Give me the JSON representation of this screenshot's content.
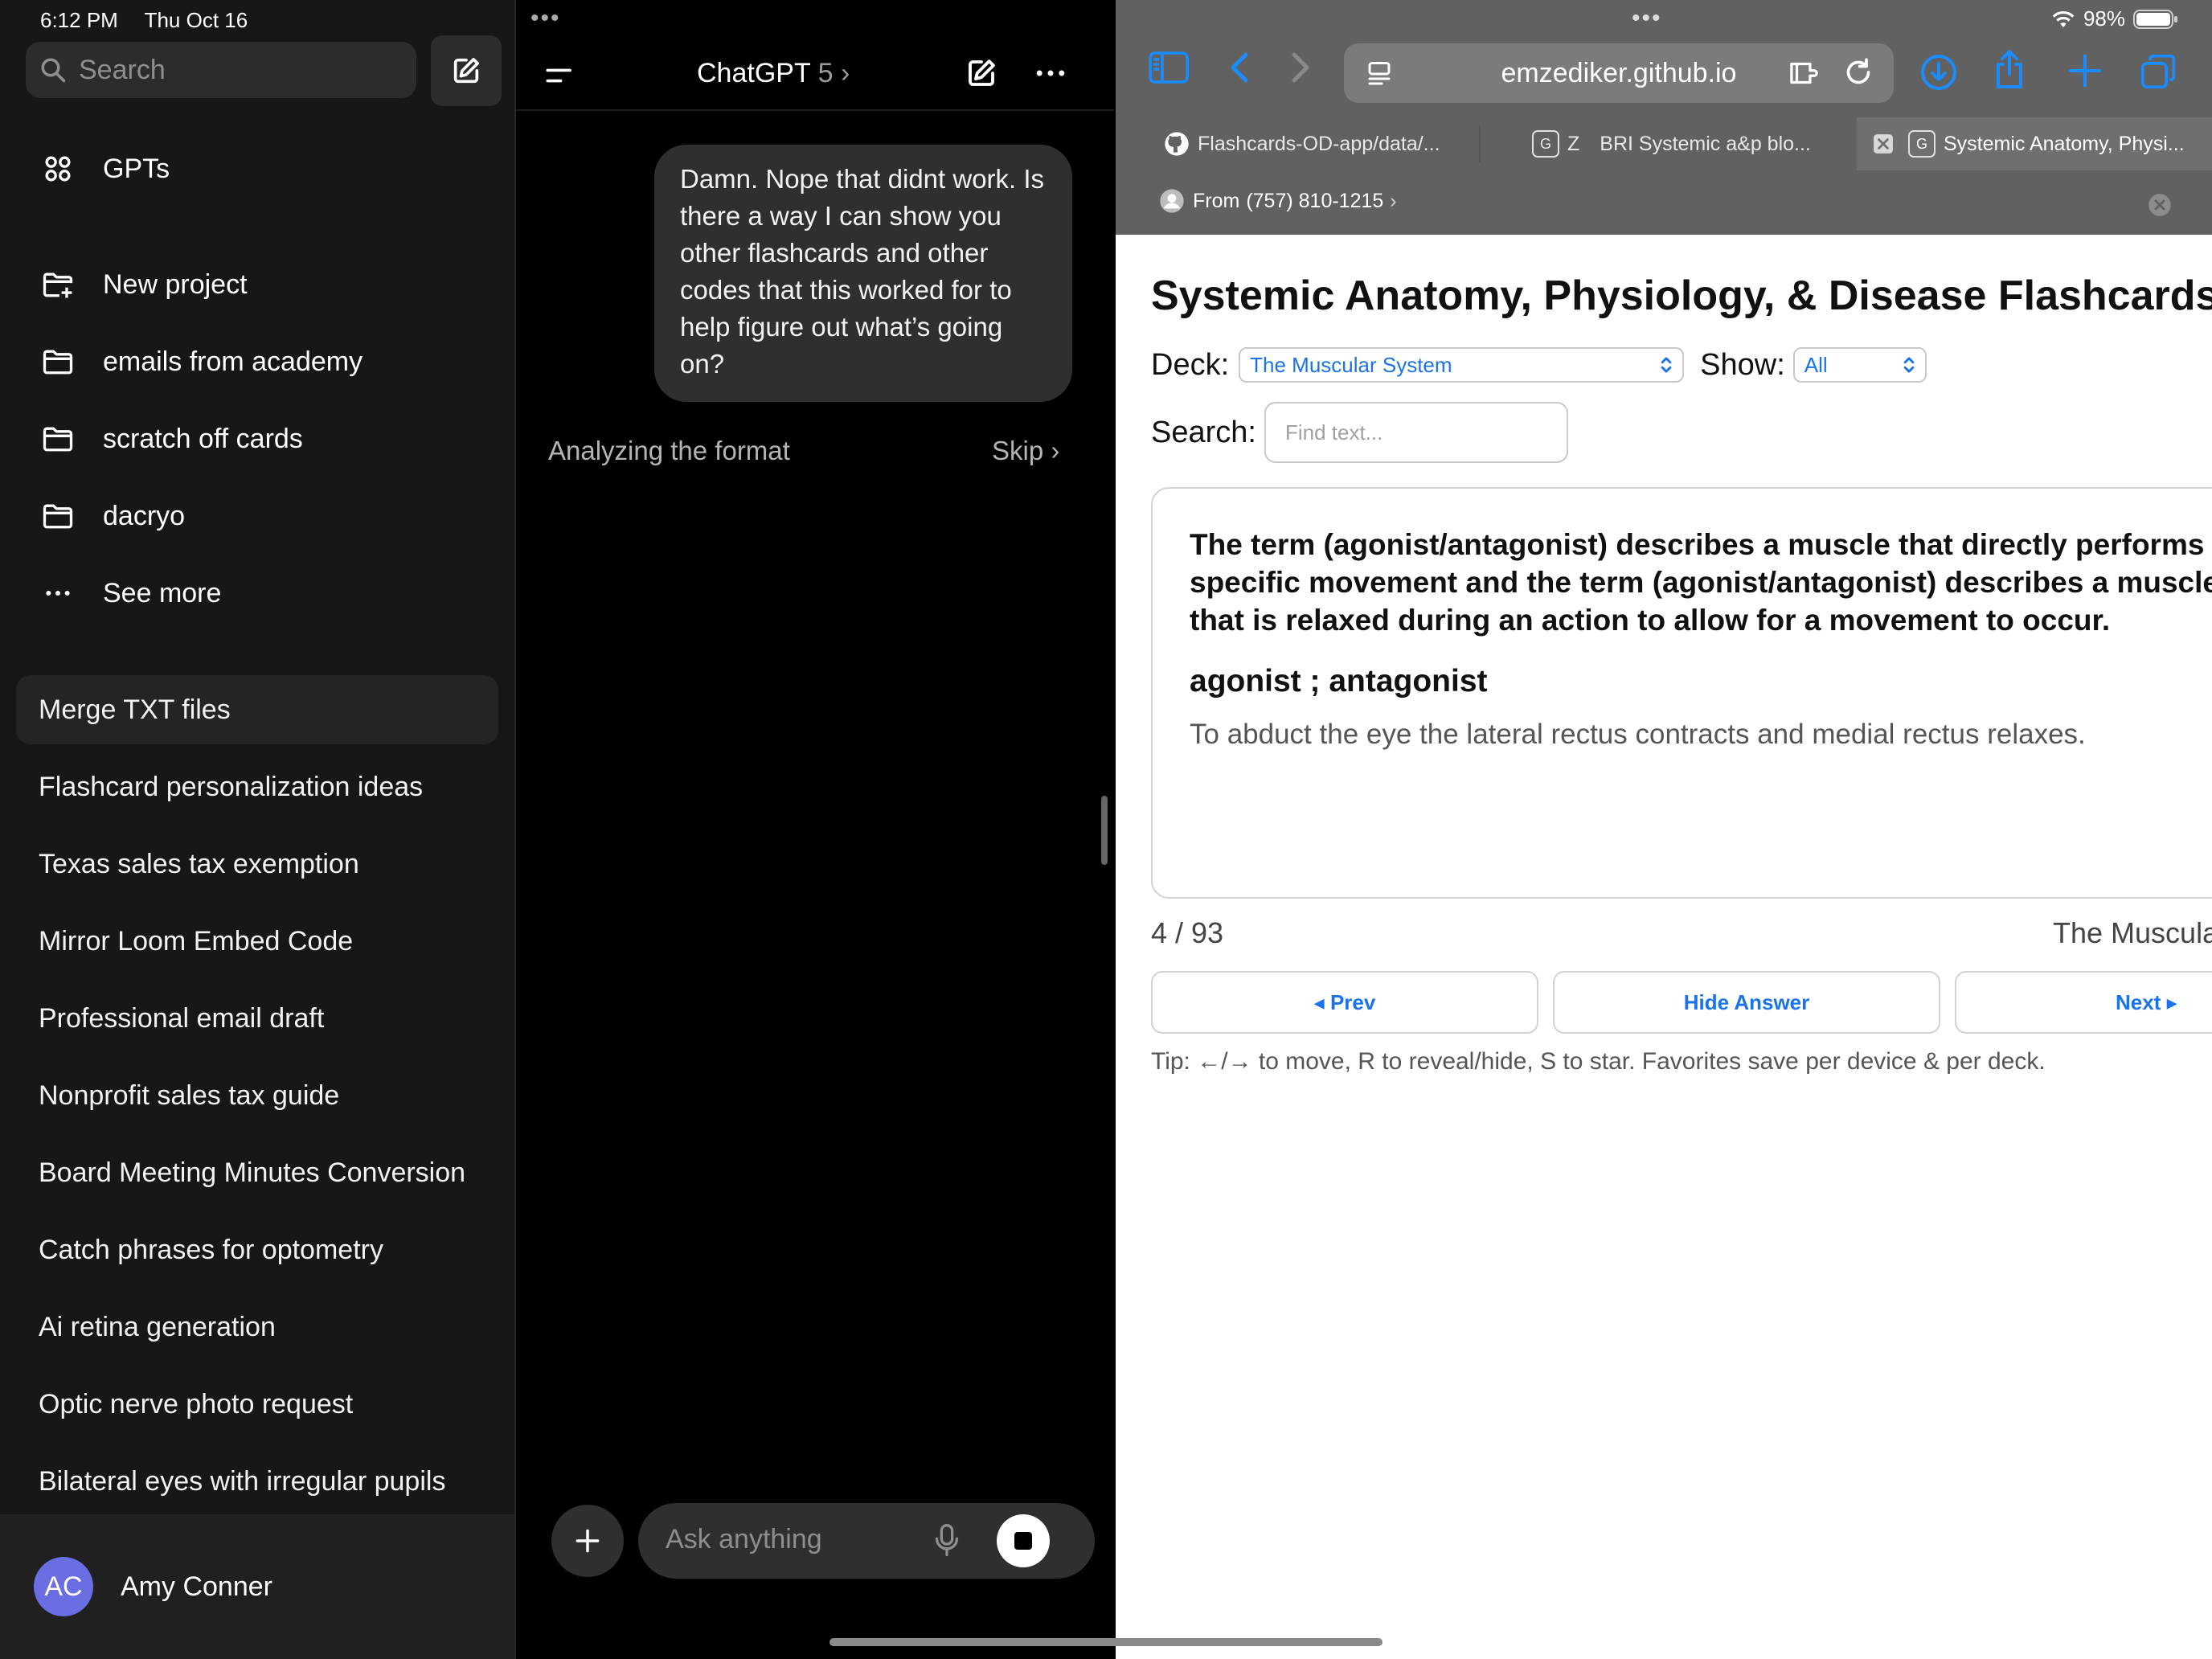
{
  "status": {
    "time": "6:12 PM",
    "date": "Thu Oct 16",
    "battery": "98%"
  },
  "sidebar": {
    "search_placeholder": "Search",
    "gpts_label": "GPTs",
    "projects": [
      {
        "label": "New project",
        "icon": "new-folder-icon"
      },
      {
        "label": "emails from academy",
        "icon": "folder-icon"
      },
      {
        "label": "scratch off cards",
        "icon": "folder-icon"
      },
      {
        "label": "dacryo",
        "icon": "folder-icon"
      }
    ],
    "see_more": "See more",
    "chats": [
      "Merge TXT files",
      "Flashcard personalization ideas",
      "Texas sales tax exemption",
      "Mirror Loom Embed Code",
      "Professional email draft",
      "Nonprofit sales tax guide",
      "Board Meeting Minutes Conversion",
      "Catch phrases for optometry",
      "Ai retina generation",
      "Optic nerve photo request",
      "Bilateral eyes with irregular pupils"
    ],
    "user": {
      "initials": "AC",
      "name": "Amy Conner",
      "avatar_color": "#6b6de3"
    }
  },
  "chat": {
    "title": "ChatGPT",
    "version": "5",
    "user_message": "Damn. Nope that didnt work. Is there a way I can show you other flashcards and other codes that this worked for to help figure out what’s going on?",
    "status": "Analyzing the format",
    "skip": "Skip",
    "input_placeholder": "Ask anything"
  },
  "safari": {
    "address": "emzediker.github.io",
    "tabs": [
      {
        "label": "Flashcards-OD-app/data/...",
        "icon": "github-icon"
      },
      {
        "label": "Z BRI Systemic a&p blo...",
        "icon": "google-icon"
      },
      {
        "label": "Systemic Anatomy, Physi...",
        "icon": "google-icon"
      }
    ],
    "from_label": "From",
    "from_number": "(757) 810-1215"
  },
  "page": {
    "title": "Systemic Anatomy, Physiology, & Disease Flashcards",
    "deck_label": "Deck:",
    "deck_value": "The Muscular System",
    "show_label": "Show:",
    "show_value": "All",
    "search_label": "Search:",
    "search_placeholder": "Find text...",
    "card_question": "The term (agonist/antagonist) describes a muscle that directly performs a specific movement and the term (agonist/antagonist) describes a muscle that is relaxed during an action to allow for a movement to occur.",
    "card_answer": "agonist ; antagonist",
    "card_note": "To abduct the eye the lateral rectus contracts and medial rectus relaxes.",
    "counter": "4 / 93",
    "deck_name_footer": "The Muscular System",
    "prev": "◂ Prev",
    "hide": "Hide Answer",
    "next": "Next ▸",
    "tip": "Tip: ←/→ to move, R to reveal/hide, S to star. Favorites save per device & per deck."
  }
}
